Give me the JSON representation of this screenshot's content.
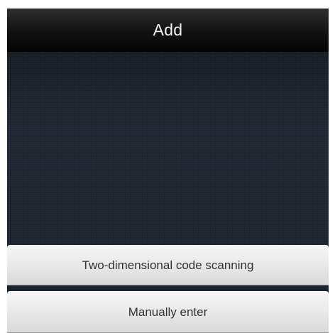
{
  "header": {
    "title": "Add"
  },
  "actions": {
    "scan_label": "Two-dimensional code scanning",
    "manual_label": "Manually enter"
  }
}
